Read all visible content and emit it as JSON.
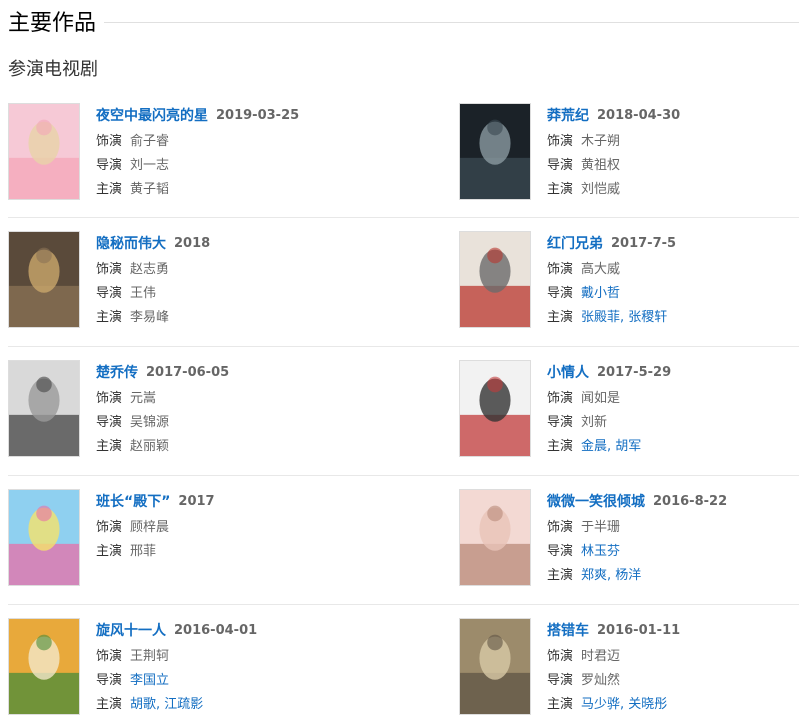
{
  "header": {
    "title": "主要作品"
  },
  "subsection": {
    "title": "参演电视剧"
  },
  "works": [
    {
      "title": "夜空中最闪亮的星",
      "date": "2019-03-25",
      "meta": [
        {
          "key": "饰演",
          "val": "俞子睿",
          "link": false
        },
        {
          "key": "导演",
          "val": "刘一志",
          "link": false
        },
        {
          "key": "主演",
          "val": "黄子韬",
          "link": false
        }
      ]
    },
    {
      "title": "莽荒纪",
      "date": "2018-04-30",
      "meta": [
        {
          "key": "饰演",
          "val": "木子朔",
          "link": false
        },
        {
          "key": "导演",
          "val": "黄祖权",
          "link": false
        },
        {
          "key": "主演",
          "val": "刘恺威",
          "link": false
        }
      ]
    },
    {
      "title": "隐秘而伟大",
      "date": "2018",
      "meta": [
        {
          "key": "饰演",
          "val": "赵志勇",
          "link": false
        },
        {
          "key": "导演",
          "val": "王伟",
          "link": false
        },
        {
          "key": "主演",
          "val": "李易峰",
          "link": false
        }
      ]
    },
    {
      "title": "红门兄弟",
      "date": "2017-7-5",
      "meta": [
        {
          "key": "饰演",
          "val": "高大威",
          "link": false
        },
        {
          "key": "导演",
          "val": "戴小哲",
          "link": true
        },
        {
          "key": "主演",
          "val": "张殿菲, 张稷轩",
          "link": true
        }
      ]
    },
    {
      "title": "楚乔传",
      "date": "2017-06-05",
      "meta": [
        {
          "key": "饰演",
          "val": "元嵩",
          "link": false
        },
        {
          "key": "导演",
          "val": "吴锦源",
          "link": false
        },
        {
          "key": "主演",
          "val": "赵丽颖",
          "link": false
        }
      ]
    },
    {
      "title": "小情人",
      "date": "2017-5-29",
      "meta": [
        {
          "key": "饰演",
          "val": "闻如是",
          "link": false
        },
        {
          "key": "导演",
          "val": "刘新",
          "link": false
        },
        {
          "key": "主演",
          "val": "金晨, 胡军",
          "link": true
        }
      ]
    },
    {
      "title": "班长“殿下”",
      "date": "2017",
      "meta": [
        {
          "key": "饰演",
          "val": "顾梓晨",
          "link": false
        },
        {
          "key": "主演",
          "val": "邢菲",
          "link": false
        }
      ]
    },
    {
      "title": "微微一笑很倾城",
      "date": "2016-8-22",
      "meta": [
        {
          "key": "饰演",
          "val": "于半珊",
          "link": false
        },
        {
          "key": "导演",
          "val": "林玉芬",
          "link": true
        },
        {
          "key": "主演",
          "val": "郑爽, 杨洋",
          "link": true
        }
      ]
    },
    {
      "title": "旋风十一人",
      "date": "2016-04-01",
      "meta": [
        {
          "key": "饰演",
          "val": "王荆轲",
          "link": false
        },
        {
          "key": "导演",
          "val": "李国立",
          "link": true
        },
        {
          "key": "主演",
          "val": "胡歌, 江疏影",
          "link": true
        }
      ]
    },
    {
      "title": "搭错车",
      "date": "2016-01-11",
      "meta": [
        {
          "key": "饰演",
          "val": "时君迈",
          "link": false
        },
        {
          "key": "导演",
          "val": "罗灿然",
          "link": false
        },
        {
          "key": "主演",
          "val": "马少骅, 关晓彤",
          "link": true
        }
      ]
    }
  ]
}
